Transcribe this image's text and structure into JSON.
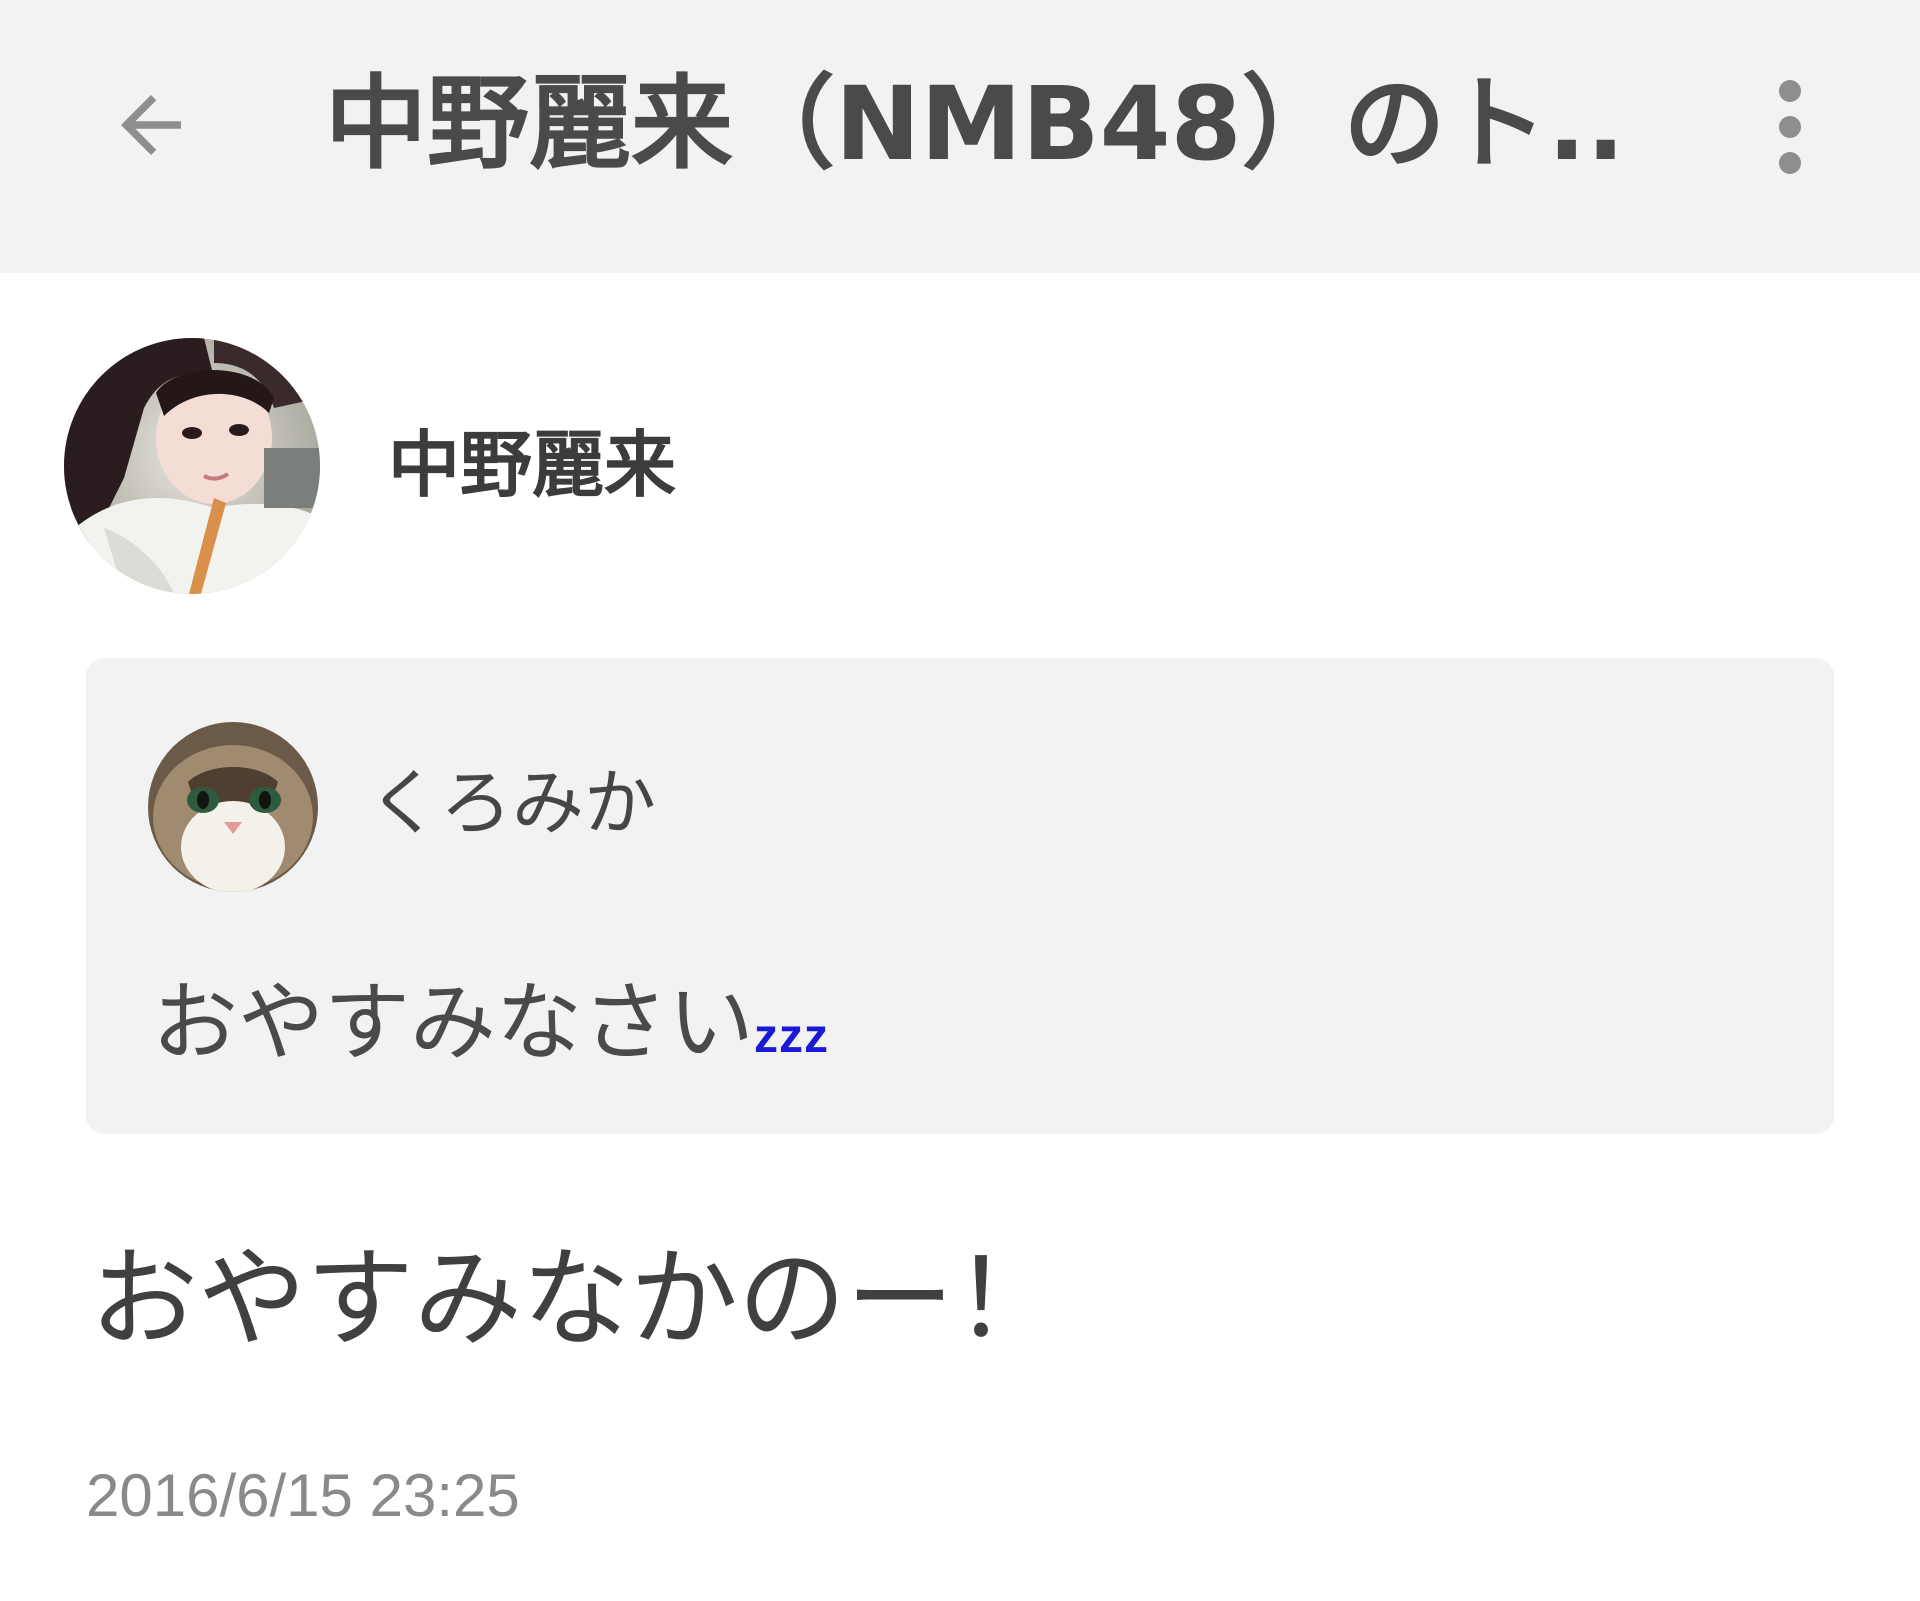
{
  "app_bar": {
    "title": "中野麗来（NMB48）のト...",
    "back_icon": "arrow-back-icon",
    "menu_icon": "more-vert-icon"
  },
  "post": {
    "author": {
      "name": "中野麗来",
      "avatar": "profile-photo"
    },
    "quoted_comment": {
      "author_name": "くろみか",
      "avatar": "cat-photo",
      "text": "おやすみなさい",
      "suffix": "zzz",
      "suffix_color": "#1a1ad6"
    },
    "body": "おやすみなかのー！",
    "timestamp": "2016/6/15 23:25"
  },
  "colors": {
    "app_bar_bg": "#f2f2f2",
    "card_bg": "#f2f2f2",
    "text": "#424242",
    "timestamp": "#8a8a8a"
  }
}
